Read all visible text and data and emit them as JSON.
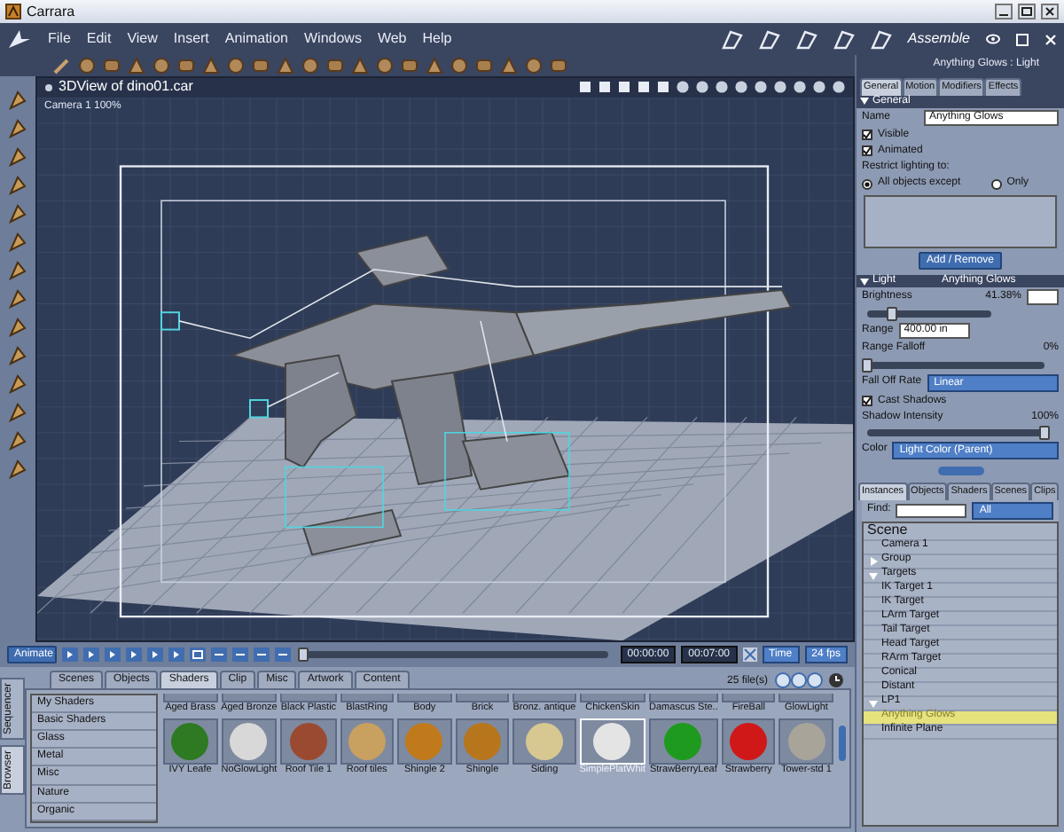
{
  "window": {
    "title": "Carrara"
  },
  "menu": [
    "File",
    "Edit",
    "View",
    "Insert",
    "Animation",
    "Windows",
    "Web",
    "Help"
  ],
  "room": {
    "label": "Assemble"
  },
  "viewport": {
    "title": "3DView of dino01.car",
    "camera": "Camera 1 100%"
  },
  "properties": {
    "heading": "Anything Glows : Light",
    "tabs": [
      {
        "label": "General",
        "selected": true
      },
      {
        "label": "Motion",
        "selected": false
      },
      {
        "label": "Modifiers",
        "selected": false
      },
      {
        "label": "Effects",
        "selected": false
      }
    ],
    "general": {
      "title": "General",
      "name_label": "Name",
      "name_value": "Anything Glows",
      "checks": [
        {
          "label": "Visible",
          "checked": true
        },
        {
          "label": "Animated",
          "checked": true
        }
      ],
      "restrict_label": "Restrict lighting to:",
      "radios": [
        {
          "label": "All objects except",
          "selected": true
        },
        {
          "label": "Only",
          "selected": false
        }
      ],
      "button": "Add / Remove"
    },
    "light": {
      "title": "Light",
      "subtitle": "Anything Glows",
      "brightness": {
        "label": "Brightness",
        "reading": "41.38%",
        "level": 0.2
      },
      "range": {
        "label": "Range",
        "value": "400.00 in"
      },
      "falloff": {
        "label": "Range Falloff",
        "reading": "0%",
        "level": 0
      },
      "rate": {
        "label": "Fall Off Rate",
        "value": "Linear"
      },
      "cast_shadows": {
        "label": "Cast Shadows",
        "checked": true
      },
      "shadow": {
        "label": "Shadow Intensity",
        "reading": "100%",
        "level": 1
      },
      "color": {
        "label": "Color",
        "value": "Light Color (Parent)"
      }
    }
  },
  "instances": {
    "tabs": [
      {
        "label": "Instances",
        "selected": true
      },
      {
        "label": "Objects",
        "selected": false
      },
      {
        "label": "Shaders",
        "selected": false
      },
      {
        "label": "Scenes",
        "selected": false
      },
      {
        "label": "Clips",
        "selected": false
      }
    ],
    "find_label": "Find:",
    "filter": "All",
    "root": "Scene",
    "items": [
      {
        "label": "Camera 1",
        "selected": false
      },
      {
        "label": "Group",
        "selected": false,
        "expanded": false
      },
      {
        "label": "Targets",
        "selected": false,
        "expanded": true,
        "children": [
          {
            "label": "IK Target 1",
            "selected": false
          },
          {
            "label": "IK Target",
            "selected": false
          },
          {
            "label": "LArm Target",
            "selected": false
          },
          {
            "label": "Tail Target",
            "selected": false
          },
          {
            "label": "Head Target",
            "selected": false
          },
          {
            "label": "RArm Target",
            "selected": false
          }
        ]
      },
      {
        "label": "Conical",
        "selected": false
      },
      {
        "label": "Distant",
        "selected": false
      },
      {
        "label": "LP1",
        "selected": false,
        "expanded": true,
        "children": [
          {
            "label": "Anything Glows",
            "selected": true
          }
        ]
      },
      {
        "label": "Infinite Plane",
        "selected": false
      }
    ]
  },
  "timeline": {
    "animate": "Animate",
    "level": 0,
    "start": "00:00:00",
    "end": "00:07:00",
    "mode": "Time",
    "fps": "24 fps"
  },
  "browser": {
    "side_tabs": [
      {
        "label": "Sequencer",
        "selected": false
      },
      {
        "label": "Browser",
        "selected": true
      }
    ],
    "tabs": [
      {
        "label": "Scenes",
        "selected": false
      },
      {
        "label": "Objects",
        "selected": false
      },
      {
        "label": "Shaders",
        "selected": true
      },
      {
        "label": "Clip",
        "selected": false
      },
      {
        "label": "Misc",
        "selected": false
      },
      {
        "label": "Artwork",
        "selected": false
      },
      {
        "label": "Content",
        "selected": false
      }
    ],
    "file_count": "25 file(s)",
    "categories": [
      "My Shaders",
      "Basic Shaders",
      "Glass",
      "Metal",
      "Misc",
      "Nature",
      "Organic"
    ],
    "top_row": [
      "Aged Brass",
      "Aged Bronze",
      "Black Plastic",
      "BlastRing",
      "Body",
      "Brick",
      "Bronz. antique",
      "ChickenSkin",
      "Damascus Ste..",
      "FireBall",
      "GlowLight"
    ],
    "shaders": [
      {
        "label": "IVY Leafe",
        "color": "#2e7a22",
        "selected": false
      },
      {
        "label": "NoGlowLight",
        "color": "#d8d8d8",
        "selected": false
      },
      {
        "label": "Roof Tile 1",
        "color": "#9a4a30",
        "selected": false
      },
      {
        "label": "Roof tiles",
        "color": "#c8a060",
        "selected": false
      },
      {
        "label": "Shingle 2",
        "color": "#c07a1c",
        "selected": false
      },
      {
        "label": "Shingle",
        "color": "#b8761c",
        "selected": false
      },
      {
        "label": "Siding",
        "color": "#d6c890",
        "selected": false
      },
      {
        "label": "SimplePlatWhit",
        "color": "#e4e4e4",
        "selected": true
      },
      {
        "label": "StrawBerryLeaf",
        "color": "#1e9a1e",
        "selected": false
      },
      {
        "label": "Strawberry",
        "color": "#d01818",
        "selected": false
      },
      {
        "label": "Tower-std 1",
        "color": "#a8a49a",
        "selected": false
      }
    ]
  }
}
